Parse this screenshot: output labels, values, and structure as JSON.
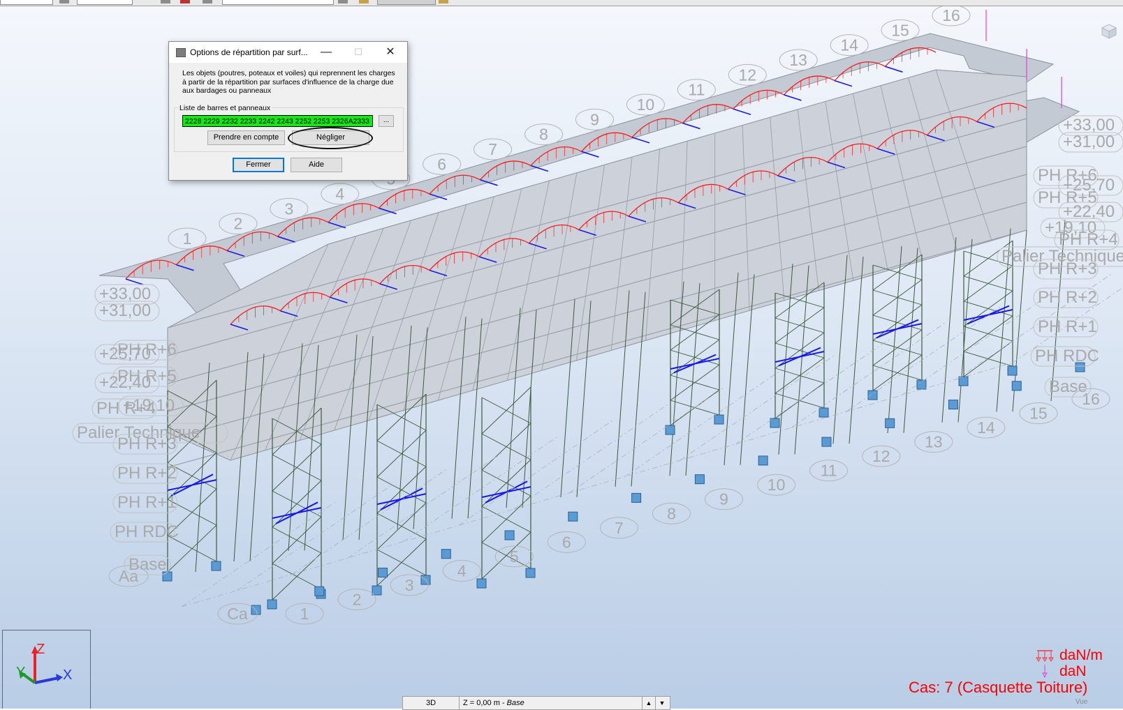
{
  "dialog": {
    "title": "Options de répartition par surf...",
    "minimize": "—",
    "maximize": "☐",
    "close": "✕",
    "description": "Les objets (poutres, poteaux et voiles) qui reprennent les charges à partir de la répartition par surfaces d'influence de la charge due aux bardages ou panneaux",
    "list_label": "Liste de barres et panneaux",
    "list_value": "2228 2229 2232 2233 2242 2243 2252 2253 2326A2333",
    "browse_label": "...",
    "prendre_label": "Prendre en compte",
    "negliger_label": "Négliger",
    "fermer_label": "Fermer",
    "aide_label": "Aide",
    "highlight_color": "#19e619"
  },
  "scene": {
    "grid_numbers_top": [
      "1",
      "2",
      "3",
      "4",
      "5",
      "6",
      "7",
      "8",
      "9",
      "10",
      "11",
      "12",
      "13",
      "14",
      "15",
      "16"
    ],
    "grid_numbers_bottom": [
      "1",
      "2",
      "3",
      "4",
      "5",
      "6",
      "7",
      "8",
      "9",
      "10",
      "11",
      "12",
      "13",
      "14",
      "15",
      "16"
    ],
    "grid_letters": [
      "Aa",
      "Ca"
    ],
    "levels_left": [
      "+33,00",
      "+31,00",
      "PH R+6",
      "+25,70",
      "PH R+5",
      "+22,40",
      "+19,10",
      "PH R+4",
      "Palier Technique",
      "PH R+3",
      "PH R+2",
      "PH R+1",
      "PH RDC",
      "Base"
    ],
    "levels_right": [
      "+33,00",
      "+31,00",
      "PH R+6",
      "+25,70",
      "PH R+5",
      "+22,40",
      "+19,10",
      "PH R+4",
      "Palier Technique",
      "PH R+3",
      "PH R+2",
      "PH R+1",
      "PH RDC",
      "Base"
    ],
    "colors": {
      "load": "#ff1a1a",
      "bracing": "#1a1ae6",
      "frame": "#3d5a3d",
      "slab": "#c4cad4",
      "support": "#5b9bd5"
    }
  },
  "axes": {
    "x": "X",
    "y": "Y",
    "z": "Z"
  },
  "units": {
    "distributed": "daN/m",
    "point": "daN"
  },
  "case_label": "Cas: 7 (Casquette Toiture)",
  "status": {
    "view": "3D",
    "z_prefix": "Z = 0,00 m - ",
    "z_level": "Base",
    "up": "▲",
    "down": "▼"
  },
  "vue_label": "Vue"
}
